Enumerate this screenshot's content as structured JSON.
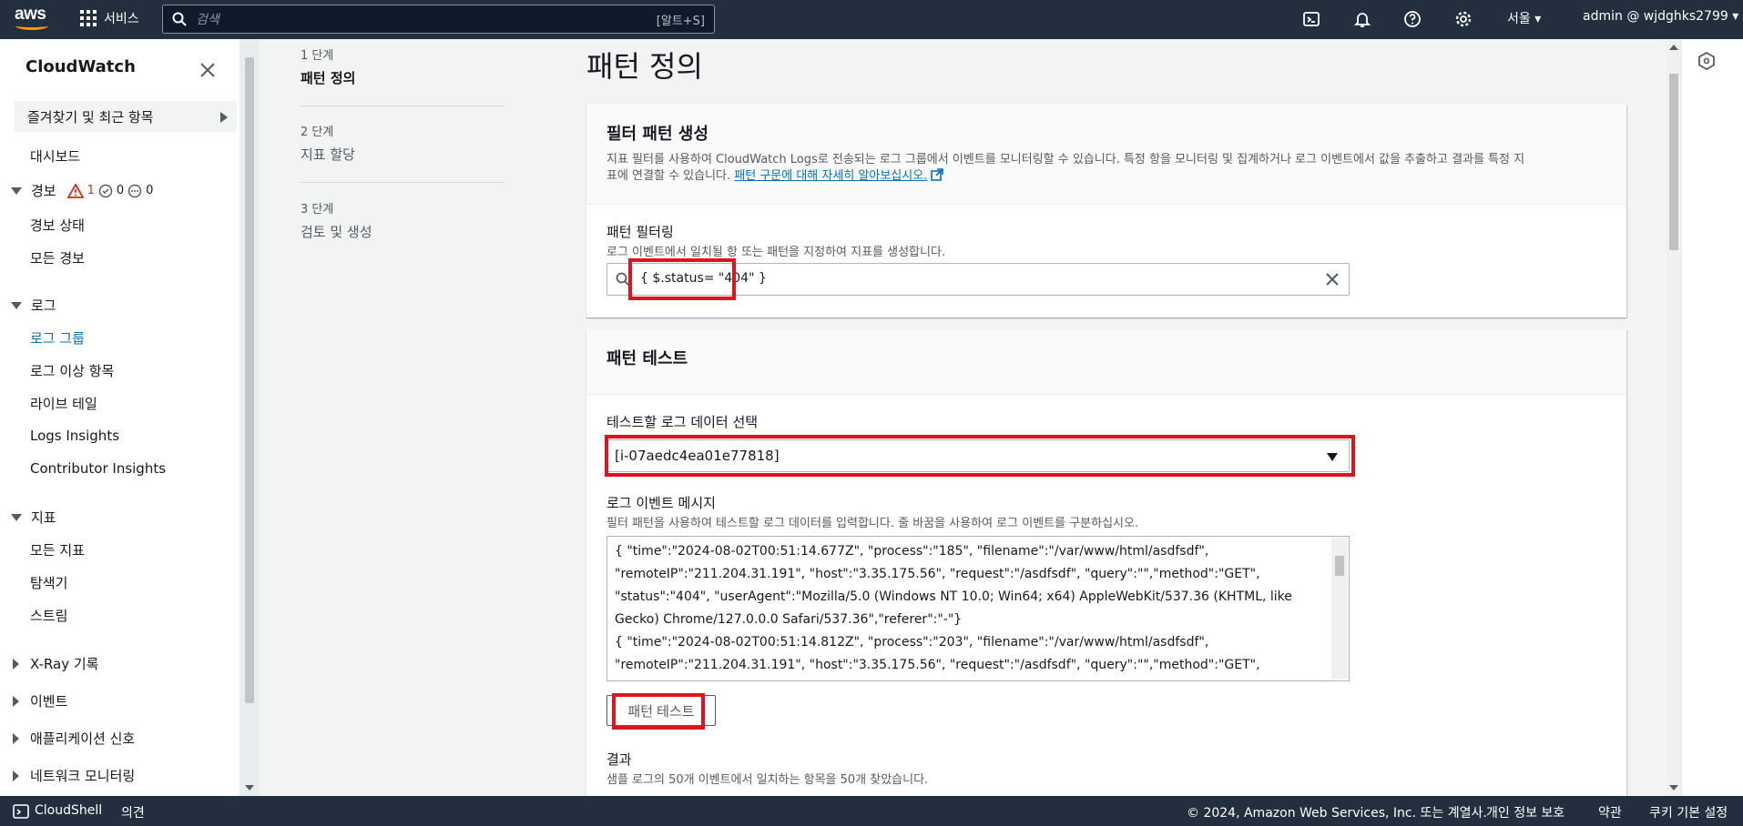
{
  "topnav": {
    "logo_text": "aws",
    "services_label": "서비스",
    "search_placeholder": "검색",
    "search_shortcut": "[알트+S]",
    "region": "서울 ▾",
    "account": "admin @ wjdghks2799 ▾",
    "icons": [
      "cloudshell-icon",
      "bell-icon",
      "help-icon",
      "settings-icon"
    ]
  },
  "sidebar": {
    "title": "CloudWatch",
    "favorites": "즐겨찾기 및 최근 항목",
    "dashboard": "대시보드",
    "alarms": {
      "label": "경보",
      "alarm_count": "1",
      "ok_count": "0",
      "insufficient_count": "0",
      "items": [
        "경보 상태",
        "모든 경보"
      ]
    },
    "logs": {
      "label": "로그",
      "items": [
        "로그 그룹",
        "로그 이상 항목",
        "라이브 테일",
        "Logs Insights",
        "Contributor Insights"
      ]
    },
    "metrics": {
      "label": "지표",
      "items": [
        "모든 지표",
        "탐색기",
        "스트림"
      ]
    },
    "collapsed": [
      "X-Ray 기록",
      "이벤트",
      "애플리케이션 신호",
      "네트워크 모니터링"
    ]
  },
  "steps": [
    {
      "num": "1 단계",
      "label": "패턴 정의"
    },
    {
      "num": "2 단계",
      "label": "지표 할당"
    },
    {
      "num": "3 단계",
      "label": "검토 및 생성"
    }
  ],
  "main": {
    "page_title": "패턴 정의",
    "create_panel": {
      "title": "필터 패턴 생성",
      "desc_line1": "지표 필터를 사용하여 CloudWatch Logs로 전송되는 로그 그룹에서 이벤트를 모니터링할 수 있습니다. 특정 항을 모니터링 및 집계하거나 로그 이벤트에서 값을 추출하고 결과를 특정 지",
      "desc_line2": "표에 연결할 수 있습니다.",
      "link": "패턴 구문에 대해 자세히 알아보십시오.",
      "filter_label": "패턴 필터링",
      "filter_desc": "로그 이벤트에서 일치될 항 또는 패턴을 지정하여 지표를 생성합니다.",
      "filter_value": "{ $.status= \"404\" }"
    },
    "test_panel": {
      "title": "패턴 테스트",
      "select_label": "테스트할 로그 데이터 선택",
      "select_value": "[i-07aedc4ea01e77818]",
      "message_label": "로그 이벤트 메시지",
      "message_desc": "필터 패턴을 사용하여 테스트할 로그 데이터를 입력합니다. 줄 바꿈을 사용하여 로그 이벤트를 구분하십시오.",
      "log_lines": [
        "{ \"time\":\"2024-08-02T00:51:14.677Z\", \"process\":\"185\", \"filename\":\"/var/www/html/asdfsdf\",",
        "\"remoteIP\":\"211.204.31.191\", \"host\":\"3.35.175.56\", \"request\":\"/asdfsdf\", \"query\":\"\",\"method\":\"GET\",",
        "\"status\":\"404\", \"userAgent\":\"Mozilla/5.0 (Windows NT 10.0; Win64; x64) AppleWebKit/537.36 (KHTML, like",
        "Gecko) Chrome/127.0.0.0 Safari/537.36\",\"referer\":\"-\"}",
        "{ \"time\":\"2024-08-02T00:51:14.812Z\", \"process\":\"203\", \"filename\":\"/var/www/html/asdfsdf\",",
        "\"remoteIP\":\"211.204.31.191\", \"host\":\"3.35.175.56\", \"request\":\"/asdfsdf\", \"query\":\"\",\"method\":\"GET\","
      ],
      "test_button": "패턴 테스트",
      "result_label": "결과",
      "result_desc": "샘플 로그의 50개 이벤트에서 일치하는 항목을 50개 찾았습니다."
    }
  },
  "footer": {
    "cloudshell": "CloudShell",
    "feedback": "의견",
    "copyright": "© 2024, Amazon Web Services, Inc. 또는 계열사.",
    "privacy": "개인 정보 보호",
    "terms": "약관",
    "cookies": "쿠키 기본 설정"
  },
  "colors": {
    "nav_bg": "#232f3e",
    "accent_link": "#0073bb",
    "highlight_red": "#e0151b",
    "alarm_red": "#d13212"
  }
}
